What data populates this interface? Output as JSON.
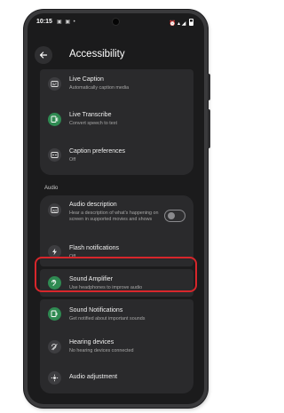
{
  "status_bar": {
    "time": "10:15",
    "notification_icons": "▣ ▣ •",
    "system_icons": "⏰ ▴ ◢"
  },
  "header": {
    "title": "Accessibility"
  },
  "captions_group": [
    {
      "title": "Live Caption",
      "subtitle": "Automatically caption media",
      "icon": "live-caption-icon"
    },
    {
      "title": "Live Transcribe",
      "subtitle": "Convert speech to text",
      "icon": "live-transcribe-icon"
    },
    {
      "title": "Caption preferences",
      "subtitle": "Off",
      "icon": "caption-preferences-icon"
    }
  ],
  "audio_section": {
    "label": "Audio"
  },
  "audio_description": {
    "title": "Audio description",
    "subtitle": "Hear a description of what's happening on screen in supported movies and shows",
    "toggle_on": false
  },
  "flash_notifications": {
    "title": "Flash notifications",
    "subtitle": "Off"
  },
  "sound_amplifier": {
    "title": "Sound Amplifier",
    "subtitle": "Use headphones to improve audio"
  },
  "sound_notifications": {
    "title": "Sound Notifications",
    "subtitle": "Get notified about important sounds"
  },
  "hearing_devices": {
    "title": "Hearing devices",
    "subtitle": "No hearing devices connected"
  },
  "audio_adjustment": {
    "title": "Audio adjustment"
  },
  "colors": {
    "background": "#1b1b1c",
    "card": "#2a2a2c",
    "accent_green": "#2f8a52",
    "highlight_red": "#d7262b"
  }
}
